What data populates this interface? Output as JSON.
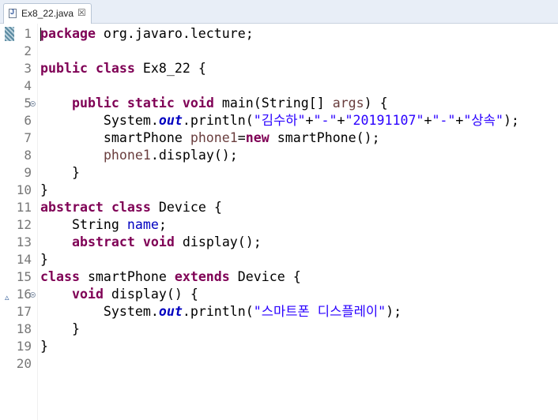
{
  "tab": {
    "label": "Ex8_22.java",
    "close_glyph": "☒"
  },
  "lines": [
    {
      "num": "1",
      "tokens": [
        {
          "t": "package",
          "c": "kw"
        },
        {
          "t": " org.javaro.lecture;"
        }
      ]
    },
    {
      "num": "2",
      "tokens": []
    },
    {
      "num": "3",
      "tokens": [
        {
          "t": "public",
          "c": "kw"
        },
        {
          "t": " "
        },
        {
          "t": "class",
          "c": "kw"
        },
        {
          "t": " Ex8_22 {"
        }
      ]
    },
    {
      "num": "4",
      "tokens": []
    },
    {
      "num": "5",
      "fold": true,
      "tokens": [
        {
          "t": "    "
        },
        {
          "t": "public",
          "c": "kw"
        },
        {
          "t": " "
        },
        {
          "t": "static",
          "c": "kw"
        },
        {
          "t": " "
        },
        {
          "t": "void",
          "c": "kw"
        },
        {
          "t": " main(String[] "
        },
        {
          "t": "args",
          "c": "var"
        },
        {
          "t": ") {"
        }
      ]
    },
    {
      "num": "6",
      "tokens": [
        {
          "t": "        System."
        },
        {
          "t": "out",
          "c": "stc"
        },
        {
          "t": ".println("
        },
        {
          "t": "\"김수하\"",
          "c": "str"
        },
        {
          "t": "+"
        },
        {
          "t": "\"-\"",
          "c": "str"
        },
        {
          "t": "+"
        },
        {
          "t": "\"20191107\"",
          "c": "str"
        },
        {
          "t": "+"
        },
        {
          "t": "\"-\"",
          "c": "str"
        },
        {
          "t": "+"
        },
        {
          "t": "\"상속\"",
          "c": "str"
        },
        {
          "t": ");"
        }
      ]
    },
    {
      "num": "7",
      "tokens": [
        {
          "t": "        smartPhone "
        },
        {
          "t": "phone1",
          "c": "var"
        },
        {
          "t": "="
        },
        {
          "t": "new",
          "c": "kw"
        },
        {
          "t": " smartPhone();"
        }
      ]
    },
    {
      "num": "8",
      "tokens": [
        {
          "t": "        "
        },
        {
          "t": "phone1",
          "c": "var"
        },
        {
          "t": ".display();"
        }
      ]
    },
    {
      "num": "9",
      "tokens": [
        {
          "t": "    }"
        }
      ]
    },
    {
      "num": "10",
      "tokens": [
        {
          "t": "}"
        }
      ]
    },
    {
      "num": "11",
      "tokens": [
        {
          "t": "abstract",
          "c": "kw"
        },
        {
          "t": " "
        },
        {
          "t": "class",
          "c": "kw"
        },
        {
          "t": " Device {"
        }
      ]
    },
    {
      "num": "12",
      "tokens": [
        {
          "t": "    String "
        },
        {
          "t": "name",
          "c": "fld"
        },
        {
          "t": ";"
        }
      ]
    },
    {
      "num": "13",
      "tokens": [
        {
          "t": "    "
        },
        {
          "t": "abstract",
          "c": "kw"
        },
        {
          "t": " "
        },
        {
          "t": "void",
          "c": "kw"
        },
        {
          "t": " display();"
        }
      ]
    },
    {
      "num": "14",
      "tokens": [
        {
          "t": "}"
        }
      ]
    },
    {
      "num": "15",
      "tokens": [
        {
          "t": "class",
          "c": "kw"
        },
        {
          "t": " smartPhone "
        },
        {
          "t": "extends",
          "c": "kw"
        },
        {
          "t": " Device {"
        }
      ]
    },
    {
      "num": "16",
      "fold": true,
      "override": true,
      "tokens": [
        {
          "t": "    "
        },
        {
          "t": "void",
          "c": "kw"
        },
        {
          "t": " display() {"
        }
      ]
    },
    {
      "num": "17",
      "tokens": [
        {
          "t": "        System."
        },
        {
          "t": "out",
          "c": "stc"
        },
        {
          "t": ".println("
        },
        {
          "t": "\"스마트폰 디스플레이\"",
          "c": "str"
        },
        {
          "t": ");"
        }
      ]
    },
    {
      "num": "18",
      "tokens": [
        {
          "t": "    }"
        }
      ]
    },
    {
      "num": "19",
      "tokens": [
        {
          "t": "}"
        }
      ]
    },
    {
      "num": "20",
      "tokens": []
    }
  ]
}
